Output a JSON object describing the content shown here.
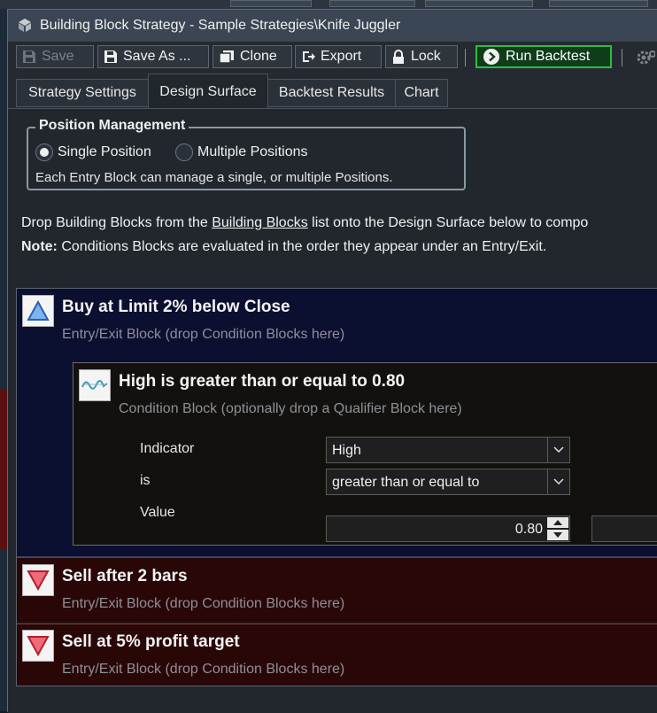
{
  "window": {
    "title": "Building Block Strategy - Sample Strategies\\Knife Juggler"
  },
  "toolbar": {
    "save_label": "Save",
    "save_as_label": "Save As ...",
    "clone_label": "Clone",
    "export_label": "Export",
    "lock_label": "Lock",
    "run_label": "Run Backtest"
  },
  "tabs": [
    {
      "label": "Strategy Settings"
    },
    {
      "label": "Design Surface"
    },
    {
      "label": "Backtest Results"
    },
    {
      "label": "Chart"
    }
  ],
  "position_management": {
    "title": "Position Management",
    "single_label": "Single Position",
    "multiple_label": "Multiple Positions",
    "selected": "Single Position",
    "description": "Each Entry Block can manage a single, or multiple Positions."
  },
  "instructions": {
    "line1_prefix": "Drop Building Blocks from the ",
    "line1_link": "Building Blocks",
    "line1_suffix": " list onto the Design Surface below to compo",
    "note_label": "Note:",
    "note_text": " Conditions Blocks are evaluated in the order they appear under an Entry/Exit."
  },
  "blocks": [
    {
      "title": "Buy at Limit 2% below Close",
      "subtitle": "Entry/Exit Block (drop Condition Blocks here)"
    },
    {
      "title": "Sell after 2 bars",
      "subtitle": "Entry/Exit Block (drop Condition Blocks here)"
    },
    {
      "title": "Sell at 5% profit target",
      "subtitle": "Entry/Exit Block (drop Condition Blocks here)"
    }
  ],
  "condition": {
    "title": "High is greater than or equal to 0.80",
    "subtitle": "Condition Block (optionally drop a Qualifier Block here)",
    "indicator_label": "Indicator",
    "indicator_value": "High",
    "is_label": "is",
    "is_value": "greater than or equal to",
    "value_label": "Value",
    "value": "0.80"
  },
  "colors": {
    "entry_block_bg": "#0b0f30",
    "exit_block_bg": "#290707",
    "run_button_accent": "#2ebb4a"
  },
  "icons": {
    "title": "building-blocks-icon",
    "save": "floppy-disk-icon",
    "save_as": "floppy-disk-icon",
    "clone": "copy-icon",
    "export": "export-icon",
    "lock": "lock-icon",
    "run": "play-circle-icon",
    "settings": "gear-icon",
    "entry": "triangle-up-icon",
    "exit": "triangle-down-icon",
    "condition": "wave-icon"
  }
}
